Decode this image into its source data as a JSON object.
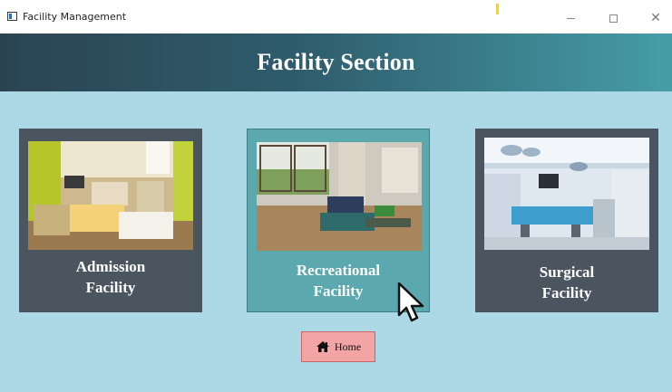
{
  "window": {
    "title": "Facility Management",
    "controls": [
      "minimize",
      "maximize",
      "close"
    ]
  },
  "header": {
    "title": "Facility Section",
    "gradient": [
      "#2b4452",
      "#469da8"
    ]
  },
  "colors": {
    "background": "#add8e6",
    "card": "#4a5560",
    "card_active": "#5ba9ae",
    "home_button": "#f3a4a4"
  },
  "cards": [
    {
      "line1": "Admission",
      "line2": "Facility",
      "image": "hospital-room-photo",
      "active": false
    },
    {
      "line1": "Recreational",
      "line2": "Facility",
      "image": "lounge-room-photo",
      "active": true
    },
    {
      "line1": "Surgical",
      "line2": "Facility",
      "image": "operating-room-photo",
      "active": false
    }
  ],
  "home_button": {
    "label": "Home",
    "icon": "home-icon"
  }
}
